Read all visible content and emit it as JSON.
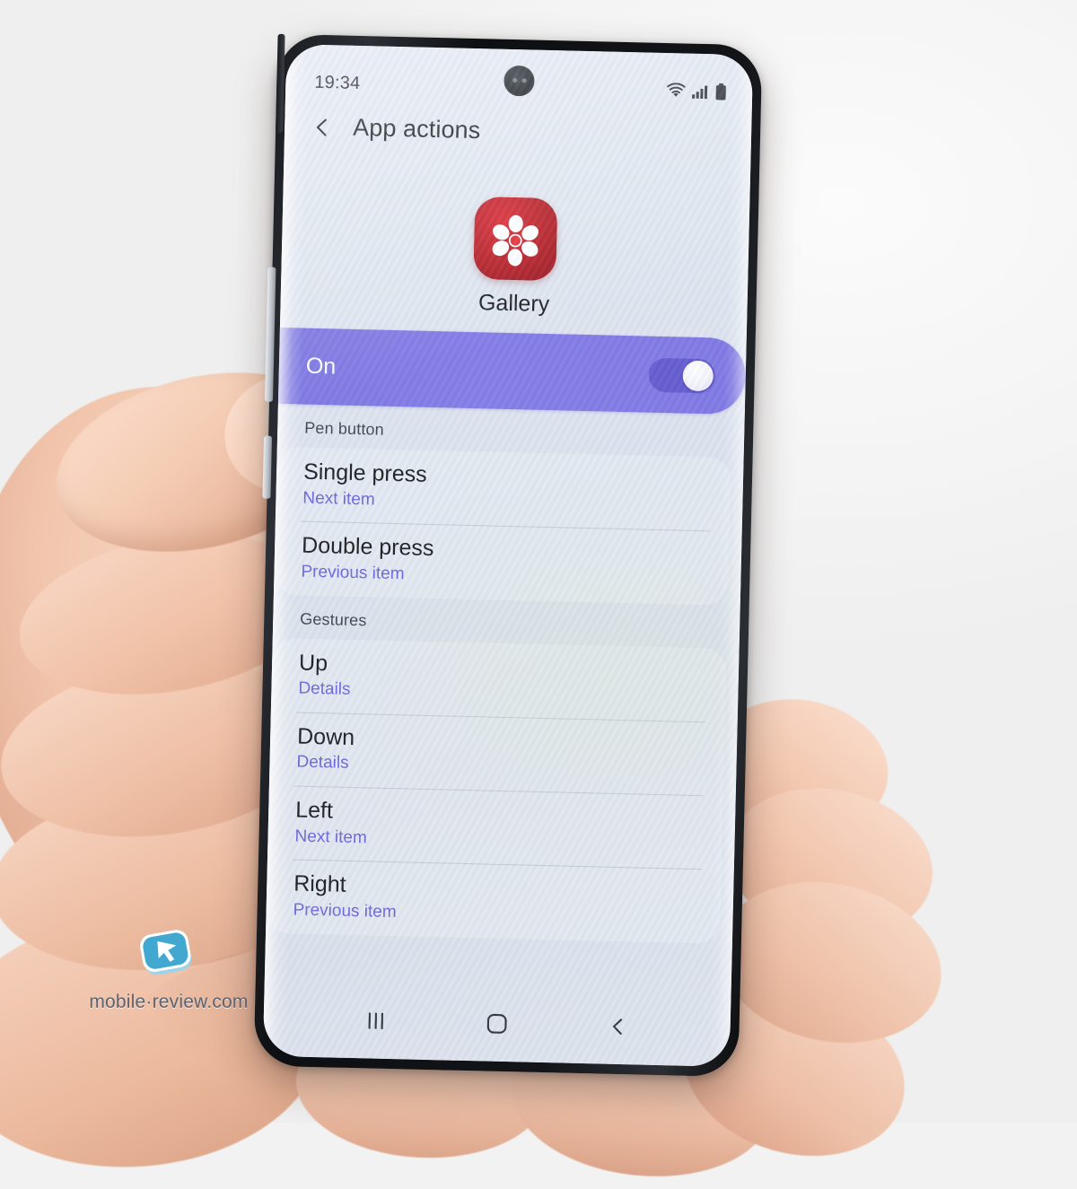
{
  "scene": {
    "device": "samsung-galaxy-note-phone",
    "background_color": "#f2f2f2"
  },
  "statusbar": {
    "time": "19:34",
    "icons": [
      "wifi-icon",
      "cellular-signal-icon",
      "battery-icon"
    ]
  },
  "header": {
    "back_icon": "back-chevron-icon",
    "title": "App actions"
  },
  "app": {
    "icon": "gallery-app-icon",
    "icon_color": "#b4151d",
    "name": "Gallery"
  },
  "master_toggle": {
    "label": "On",
    "state": "on",
    "accent_color": "#7b73e2"
  },
  "sections": [
    {
      "header": "Pen button",
      "rows": [
        {
          "title": "Single press",
          "subtitle": "Next item"
        },
        {
          "title": "Double press",
          "subtitle": "Previous item"
        }
      ]
    },
    {
      "header": "Gestures",
      "rows": [
        {
          "title": "Up",
          "subtitle": "Details"
        },
        {
          "title": "Down",
          "subtitle": "Details"
        },
        {
          "title": "Left",
          "subtitle": "Next item"
        },
        {
          "title": "Right",
          "subtitle": "Previous item"
        }
      ]
    }
  ],
  "navbar": {
    "recents_icon": "recents-bars-icon",
    "home_icon": "home-square-icon",
    "back_icon": "back-chevron-icon"
  },
  "watermark": {
    "logo_icon": "mobile-review-cursor-logo",
    "text": "mobile·review.com",
    "brand_color": "#43a8d0"
  },
  "colors": {
    "screen_bg": "#dee2ec",
    "accent_purple": "#7b73e2",
    "subtitle_purple": "#6963d6",
    "text_primary": "#16171b"
  }
}
